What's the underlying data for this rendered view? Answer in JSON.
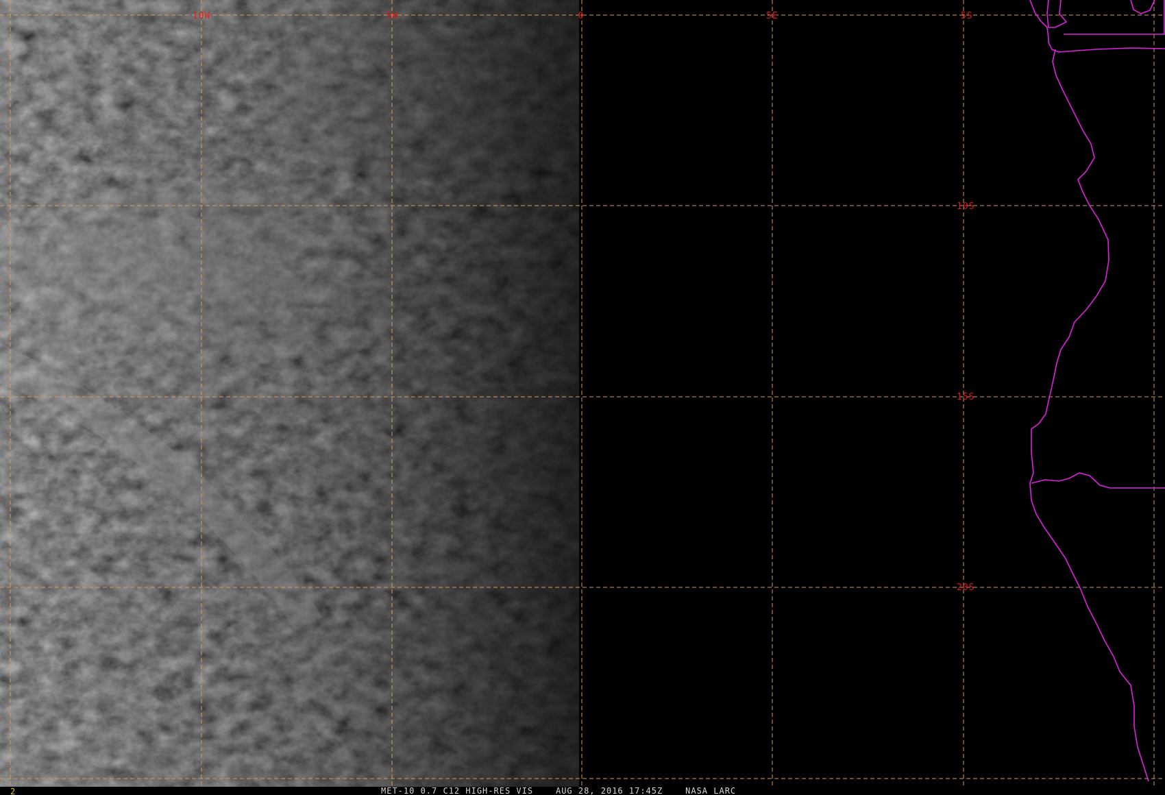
{
  "viewer": {
    "frame_number": "2",
    "status_line": "MET-10 0.7 C12 HIGH-RES VIS    AUG 28, 2016 17:45Z    NASA LARC"
  },
  "map": {
    "longitude_labels": [
      "10W",
      "5W",
      "0",
      "5E"
    ],
    "latitude_labels": [
      "5S",
      "10S",
      "15S",
      "20S"
    ],
    "colors": {
      "background": "#000000",
      "graticule": "#d89a5a",
      "grid_label": "#e01818",
      "coastline": "#e020e0",
      "frame_number": "#e0d000",
      "status_text": "#d8d8d8"
    }
  },
  "imagery": {
    "description_visible": "visible-channel cloud imagery over the South Atlantic, daylight to the west, night (black) east of the terminator"
  }
}
